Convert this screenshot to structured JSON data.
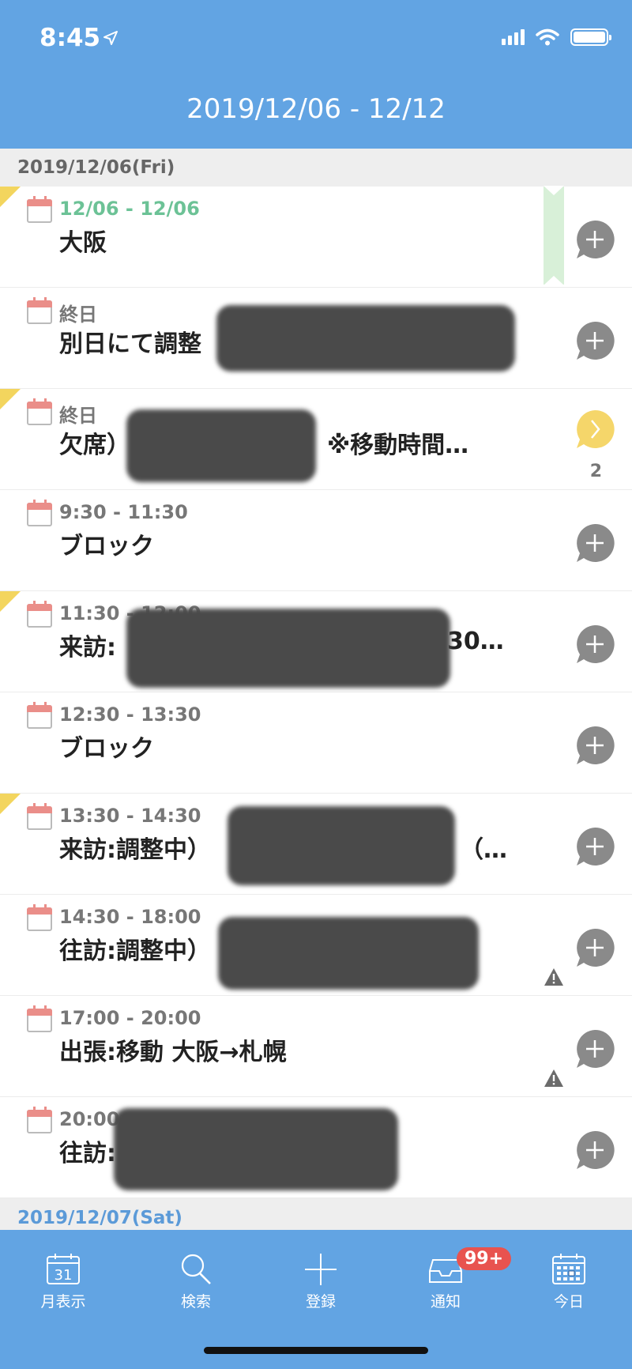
{
  "status": {
    "time": "8:45"
  },
  "header": {
    "title": "2019/12/06 - 12/12"
  },
  "sections": [
    {
      "date": "2019/12/06(Fri)"
    },
    {
      "date": "2019/12/07(Sat)"
    }
  ],
  "events": [
    {
      "time": "12/06 - 12/06",
      "title": "大阪"
    },
    {
      "time": "終日",
      "title": "別日にて調整"
    },
    {
      "time": "終日",
      "title": "欠席）",
      "title_tail": "※移動時間…",
      "comment_count": "2"
    },
    {
      "time": "9:30 - 11:30",
      "title": "ブロック"
    },
    {
      "time": "11:30 - 12:00",
      "title": "来訪:",
      "title_tail": "30…"
    },
    {
      "time": "12:30 - 13:30",
      "title": "ブロック"
    },
    {
      "time": "13:30 - 14:30",
      "title": "来訪:調整中）",
      "title_tail": "（…"
    },
    {
      "time": "14:30 - 18:00",
      "title": "往訪:調整中）"
    },
    {
      "time": "17:00 - 20:00",
      "title": "出張:移動 大阪→札幌"
    },
    {
      "time": "20:00 -",
      "title": "往訪:"
    }
  ],
  "tabbar": {
    "month": "月表示",
    "month_icon_day": "31",
    "search": "検索",
    "register": "登録",
    "notify": "通知",
    "notify_badge": "99+",
    "today": "今日"
  },
  "colors": {
    "header": "#62a4e3",
    "flag": "#f3d55e",
    "green_time": "#6cc296",
    "badge": "#e8534f",
    "comment_active": "#f5d66a"
  }
}
